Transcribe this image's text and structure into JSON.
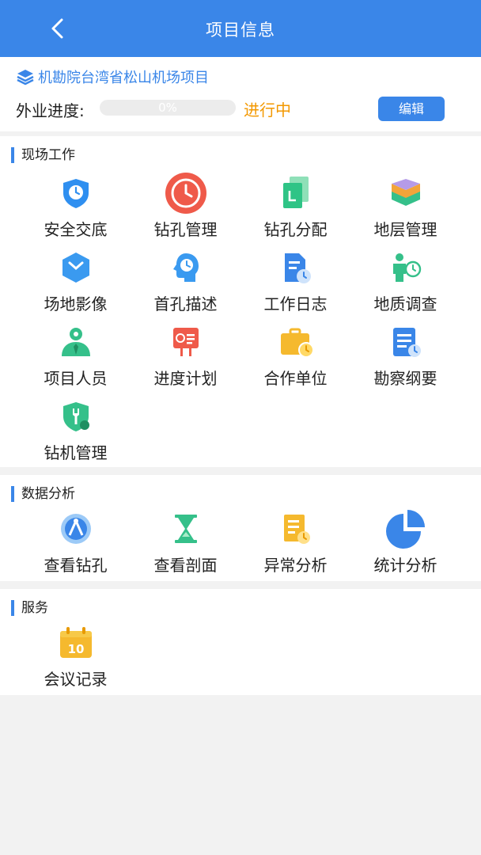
{
  "header": {
    "title": "项目信息",
    "back_icon": "chevron-left-icon"
  },
  "project": {
    "name": "机勘院台湾省松山机场项目",
    "progress_label": "外业进度:",
    "progress_value": 0,
    "progress_text": "0%",
    "status": "进行中",
    "edit_label": "编辑"
  },
  "colors": {
    "primary": "#3a86e8",
    "status": "#f39800",
    "background": "#f2f2f2"
  },
  "sections": [
    {
      "title": "现场工作",
      "items": [
        {
          "label": "安全交底",
          "icon": "safety-shield-icon"
        },
        {
          "label": "钻孔管理",
          "icon": "clock-icon"
        },
        {
          "label": "钻孔分配",
          "icon": "document-copy-icon"
        },
        {
          "label": "地层管理",
          "icon": "layers-icon"
        },
        {
          "label": "场地影像",
          "icon": "hexagon-clock-icon"
        },
        {
          "label": "首孔描述",
          "icon": "head-clock-icon"
        },
        {
          "label": "工作日志",
          "icon": "log-document-icon"
        },
        {
          "label": "地质调查",
          "icon": "person-clock-icon"
        },
        {
          "label": "项目人员",
          "icon": "person-icon"
        },
        {
          "label": "进度计划",
          "icon": "schedule-board-icon"
        },
        {
          "label": "合作单位",
          "icon": "briefcase-clock-icon"
        },
        {
          "label": "勘察纲要",
          "icon": "outline-document-icon"
        },
        {
          "label": "钻机管理",
          "icon": "wrench-shield-icon"
        }
      ]
    },
    {
      "title": "数据分析",
      "items": [
        {
          "label": "查看钻孔",
          "icon": "compass-icon"
        },
        {
          "label": "查看剖面",
          "icon": "hourglass-icon"
        },
        {
          "label": "异常分析",
          "icon": "report-clock-icon"
        },
        {
          "label": "统计分析",
          "icon": "pie-chart-icon"
        }
      ]
    },
    {
      "title": "服务",
      "items": [
        {
          "label": "会议记录",
          "icon": "calendar-icon"
        }
      ]
    }
  ]
}
